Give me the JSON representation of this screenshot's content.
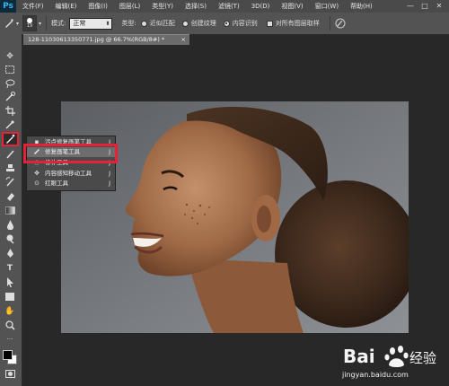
{
  "app": {
    "logo": "Ps"
  },
  "menubar": {
    "items": [
      "文件(F)",
      "编辑(E)",
      "图像(I)",
      "图层(L)",
      "类型(Y)",
      "选择(S)",
      "滤镜(T)",
      "3D(D)",
      "视图(V)",
      "窗口(W)",
      "帮助(H)"
    ],
    "window_controls": [
      "—",
      "□",
      "✕"
    ]
  },
  "options_bar": {
    "brush_size": "19",
    "mode_label": "模式:",
    "mode_value": "正常",
    "type_label": "类型:",
    "type_options": [
      "近似匹配",
      "创建纹理",
      "内容识别"
    ],
    "type_selected": "内容识别",
    "sample_all_label": "对所有图层取样"
  },
  "document": {
    "tab_title": "128-11030613350771.jpg @ 66.7%(RGB/8#) *",
    "close": "×"
  },
  "flyout": {
    "items": [
      {
        "label": "污点修复画笔工具",
        "key": "J",
        "icon": "spot-healing-icon"
      },
      {
        "label": "修复画笔工具",
        "key": "J",
        "icon": "healing-brush-icon"
      },
      {
        "label": "修补工具",
        "key": "J",
        "icon": "patch-icon"
      },
      {
        "label": "内容感知移动工具",
        "key": "J",
        "icon": "content-aware-move-icon"
      },
      {
        "label": "红眼工具",
        "key": "J",
        "icon": "red-eye-icon"
      }
    ],
    "selected_index": 1
  },
  "watermark": {
    "brand_text": "Bai",
    "brand_suffix": "经验",
    "url": "jingyan.baidu.com"
  },
  "colors": {
    "highlight": "#e8213a",
    "toolbar": "#535353",
    "background": "#282828"
  }
}
